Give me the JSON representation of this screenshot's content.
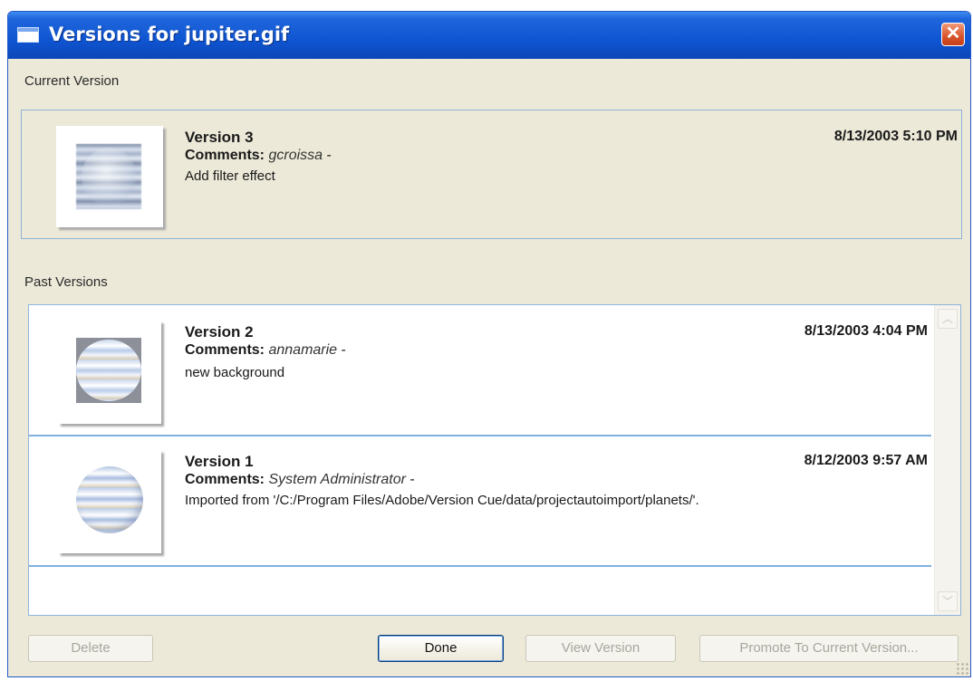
{
  "window": {
    "title": "Versions for jupiter.gif",
    "close_glyph": "✕"
  },
  "current_section": {
    "label": "Current Version",
    "version": {
      "title": "Version 3",
      "comments_label": "Comments:",
      "author": "gcroissa",
      "separator": "-",
      "description": "Add filter effect",
      "date": "8/13/2003 5:10 PM",
      "thumbnail_icon": "jupiter-filtered-thumbnail"
    }
  },
  "past_section": {
    "label": "Past Versions",
    "versions": [
      {
        "title": "Version 2",
        "comments_label": "Comments:",
        "author": "annamarie",
        "separator": "-",
        "description": "new background",
        "date": "8/13/2003 4:04 PM",
        "thumbnail_icon": "jupiter-square-thumbnail"
      },
      {
        "title": "Version 1",
        "comments_label": "Comments:",
        "author": "System Administrator",
        "separator": "-",
        "description": "Imported from '/C:/Program Files/Adobe/Version Cue/data/projectautoimport/planets/'.",
        "date": "8/12/2003 9:57 AM",
        "thumbnail_icon": "jupiter-round-thumbnail"
      }
    ]
  },
  "buttons": {
    "delete": "Delete",
    "done": "Done",
    "view_version": "View Version",
    "promote": "Promote To Current Version..."
  },
  "scrollbar": {
    "up_glyph": "︿",
    "down_glyph": "﹀"
  },
  "colors": {
    "titlebar": "#0f55d2",
    "dialog_bg": "#ece9d8",
    "separator": "#7fb0df",
    "close_button": "#d9532a"
  }
}
